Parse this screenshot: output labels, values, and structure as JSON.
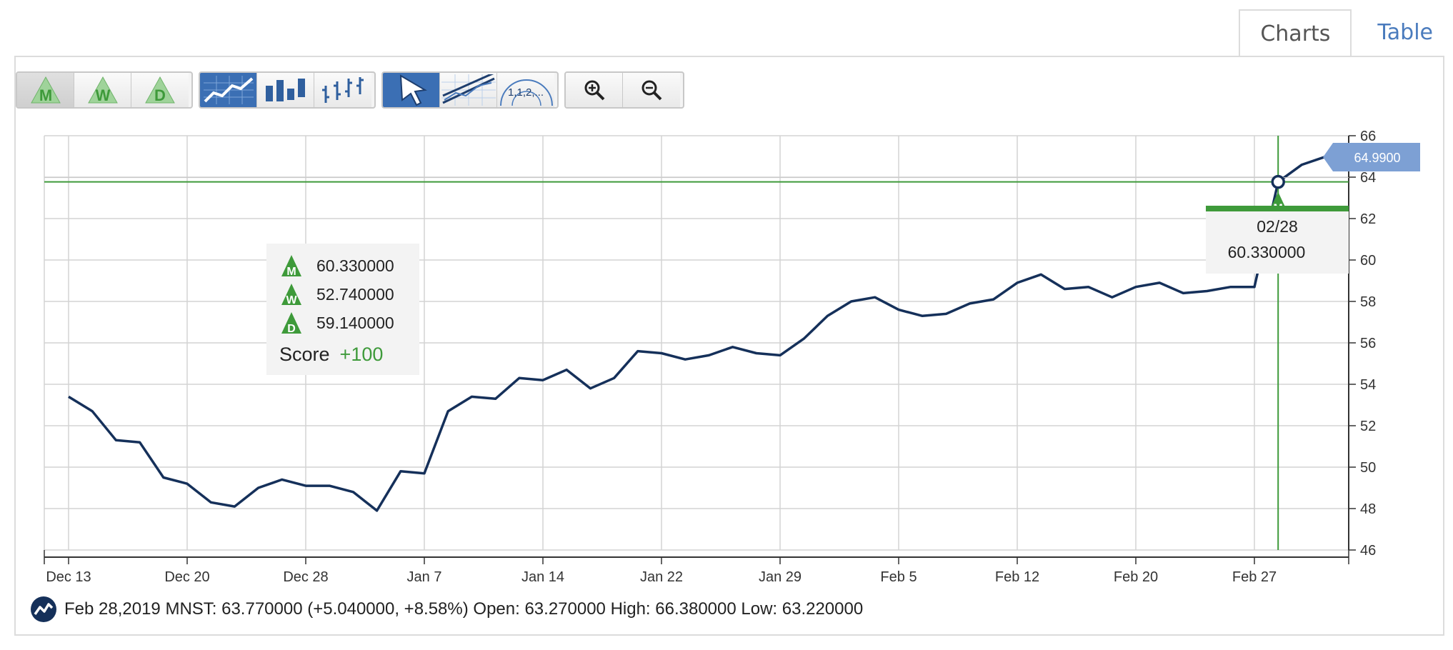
{
  "tabs": [
    {
      "label": "Charts",
      "active": true
    },
    {
      "label": "Table",
      "active": false
    }
  ],
  "toolbar": {
    "rating_buttons": [
      {
        "letter": "M",
        "icon": "monthly-rating-icon"
      },
      {
        "letter": "W",
        "icon": "weekly-rating-icon"
      },
      {
        "letter": "D",
        "icon": "daily-rating-icon"
      }
    ],
    "chart_type_buttons": [
      "line-chart-icon",
      "bar-chart-icon",
      "ohlc-chart-icon"
    ],
    "tool_buttons": [
      "pointer-icon",
      "trend-lines-icon",
      "fibonacci-icon"
    ],
    "fibonacci_label": "1,1,2,...",
    "zoom_buttons": [
      "zoom-in-icon",
      "zoom-out-icon"
    ]
  },
  "colors": {
    "line": "#15305a",
    "green": "#3e9a3a",
    "accent_blue": "#3b6fb4",
    "price_tag": "#7da0d4",
    "grid": "#d4d4d4"
  },
  "chart_data": {
    "type": "line",
    "symbol": "MNST",
    "x_tick_labels": [
      "Dec 13",
      "Dec 20",
      "Dec 28",
      "Jan 7",
      "Jan 14",
      "Jan 22",
      "Jan 29",
      "Feb 5",
      "Feb 12",
      "Feb 20",
      "Feb 27"
    ],
    "y_ticks": [
      46,
      48,
      50,
      52,
      54,
      56,
      58,
      60,
      62,
      64,
      66
    ],
    "ylim": [
      46,
      66
    ],
    "grid": true,
    "series": [
      {
        "points": [
          [
            "Dec 13",
            53.4
          ],
          [
            "Dec 14",
            52.7
          ],
          [
            "Dec 17",
            51.3
          ],
          [
            "Dec 18",
            51.2
          ],
          [
            "Dec 19",
            49.5
          ],
          [
            "Dec 20",
            49.2
          ],
          [
            "Dec 21",
            48.3
          ],
          [
            "Dec 24",
            48.1
          ],
          [
            "Dec 26",
            49.0
          ],
          [
            "Dec 27",
            49.4
          ],
          [
            "Dec 28",
            49.1
          ],
          [
            "Dec 31",
            49.1
          ],
          [
            "Jan 2",
            48.8
          ],
          [
            "Jan 3",
            47.9
          ],
          [
            "Jan 4",
            49.8
          ],
          [
            "Jan 7",
            49.7
          ],
          [
            "Jan 8",
            52.7
          ],
          [
            "Jan 9",
            53.4
          ],
          [
            "Jan 10",
            53.3
          ],
          [
            "Jan 11",
            54.3
          ],
          [
            "Jan 14",
            54.2
          ],
          [
            "Jan 15",
            54.7
          ],
          [
            "Jan 16",
            53.8
          ],
          [
            "Jan 17",
            54.3
          ],
          [
            "Jan 18",
            55.6
          ],
          [
            "Jan 22",
            55.5
          ],
          [
            "Jan 23",
            55.2
          ],
          [
            "Jan 24",
            55.4
          ],
          [
            "Jan 25",
            55.8
          ],
          [
            "Jan 28",
            55.5
          ],
          [
            "Jan 29",
            55.4
          ],
          [
            "Jan 30",
            56.2
          ],
          [
            "Jan 31",
            57.3
          ],
          [
            "Feb 1",
            58.0
          ],
          [
            "Feb 4",
            58.2
          ],
          [
            "Feb 5",
            57.6
          ],
          [
            "Feb 6",
            57.3
          ],
          [
            "Feb 7",
            57.4
          ],
          [
            "Feb 8",
            57.9
          ],
          [
            "Feb 11",
            58.1
          ],
          [
            "Feb 12",
            58.9
          ],
          [
            "Feb 13",
            59.3
          ],
          [
            "Feb 14",
            58.6
          ],
          [
            "Feb 15",
            58.7
          ],
          [
            "Feb 19",
            58.2
          ],
          [
            "Feb 20",
            58.7
          ],
          [
            "Feb 21",
            58.9
          ],
          [
            "Feb 22",
            58.4
          ],
          [
            "Feb 25",
            58.5
          ],
          [
            "Feb 26",
            58.7
          ],
          [
            "Feb 27",
            58.7
          ],
          [
            "Feb 28",
            63.77
          ],
          [
            "Mar 1",
            64.6
          ],
          [
            "Mar 4",
            64.99
          ]
        ]
      }
    ],
    "crosshair": {
      "date": "Feb 28",
      "value": 63.77
    },
    "marker_letter": "M",
    "last_price_label": "64.9900",
    "last_price": 64.99
  },
  "score_panel": {
    "rows": [
      {
        "letter": "M",
        "value": "60.330000"
      },
      {
        "letter": "W",
        "value": "52.740000"
      },
      {
        "letter": "D",
        "value": "59.140000"
      }
    ],
    "score_label": "Score",
    "score_value": "+100"
  },
  "date_panel": {
    "date": "02/28",
    "value": "60.330000"
  },
  "status": {
    "text": "Feb 28,2019 MNST: 63.770000 (+5.040000, +8.58%) Open: 63.270000 High: 66.380000 Low: 63.220000"
  }
}
